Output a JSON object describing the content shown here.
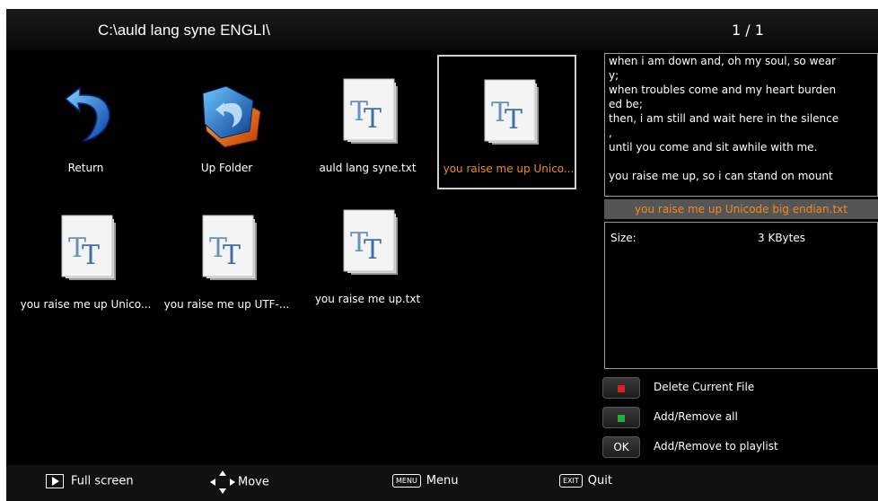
{
  "header": {
    "path": "C:\\auld lang syne ENGLI\\",
    "page": "1 / 1"
  },
  "files": [
    {
      "label": "Return",
      "icon": "return-arrow-icon"
    },
    {
      "label": "Up Folder",
      "icon": "folder-up-icon"
    },
    {
      "label": "auld lang syne.txt",
      "icon": "text-file-icon"
    },
    {
      "label": "you raise me up Unico...",
      "icon": "text-file-icon",
      "selected": true
    },
    {
      "label": "you raise me up Unico...",
      "icon": "text-file-icon"
    },
    {
      "label": "you raise me up UTF-...",
      "icon": "text-file-icon"
    },
    {
      "label": "you raise me up.txt",
      "icon": "text-file-icon"
    }
  ],
  "preview": {
    "lines": [
      "when i am down and, oh my soul, so wear",
      "y;",
      "when troubles come and my heart burden",
      "ed be;",
      "then, i am still and wait here in the silence",
      ",",
      "until you come and sit awhile with me.",
      "",
      "you raise me up, so i can stand on mount"
    ]
  },
  "selected_file_name": "you raise me up Unicode big endian.txt",
  "info": {
    "size_key": "Size:",
    "size_value": "3 KBytes"
  },
  "actions": [
    {
      "color": "#e02020",
      "label": "Delete Current File"
    },
    {
      "color": "#20b040",
      "label": "Add/Remove all"
    },
    {
      "key": "OK",
      "label": "Add/Remove to playlist"
    }
  ],
  "footer": {
    "fullscreen": "Full screen",
    "move": "Move",
    "menu_key": "MENU",
    "menu": "Menu",
    "exit_key": "EXIT",
    "quit": "Quit"
  }
}
